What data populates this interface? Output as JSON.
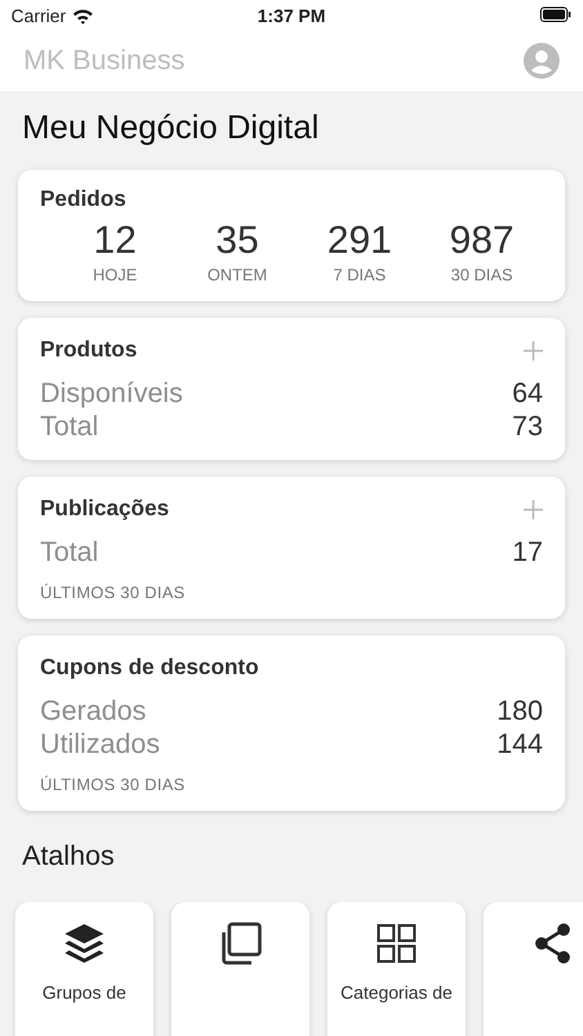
{
  "status_bar": {
    "carrier": "Carrier",
    "time": "1:37 PM"
  },
  "nav_bar": {
    "title": "MK Business"
  },
  "page_title": "Meu Negócio Digital",
  "orders": {
    "title": "Pedidos",
    "stats": [
      {
        "value": "12",
        "label": "HOJE"
      },
      {
        "value": "35",
        "label": "ONTEM"
      },
      {
        "value": "291",
        "label": "7 DIAS"
      },
      {
        "value": "987",
        "label": "30 DIAS"
      }
    ]
  },
  "cards": [
    {
      "title": "Produtos",
      "add_button": true,
      "rows": [
        {
          "label": "Disponíveis",
          "value": "64"
        },
        {
          "label": "Total",
          "value": "73"
        }
      ]
    },
    {
      "title": "Publicações",
      "add_button": true,
      "rows": [
        {
          "label": "Total",
          "value": "17"
        }
      ],
      "footnote": "ÚLTIMOS 30 DIAS"
    },
    {
      "title": "Cupons de desconto",
      "add_button": false,
      "rows": [
        {
          "label": "Gerados",
          "value": "180"
        },
        {
          "label": "Utilizados",
          "value": "144"
        }
      ],
      "footnote": "ÚLTIMOS 30 DIAS"
    }
  ],
  "shortcuts": {
    "title": "Atalhos",
    "items": [
      {
        "kind": "layers",
        "label": "Grupos de"
      },
      {
        "kind": "copy"
      },
      {
        "kind": "grid",
        "label": "Categorias de"
      },
      {
        "kind": "share"
      }
    ]
  }
}
